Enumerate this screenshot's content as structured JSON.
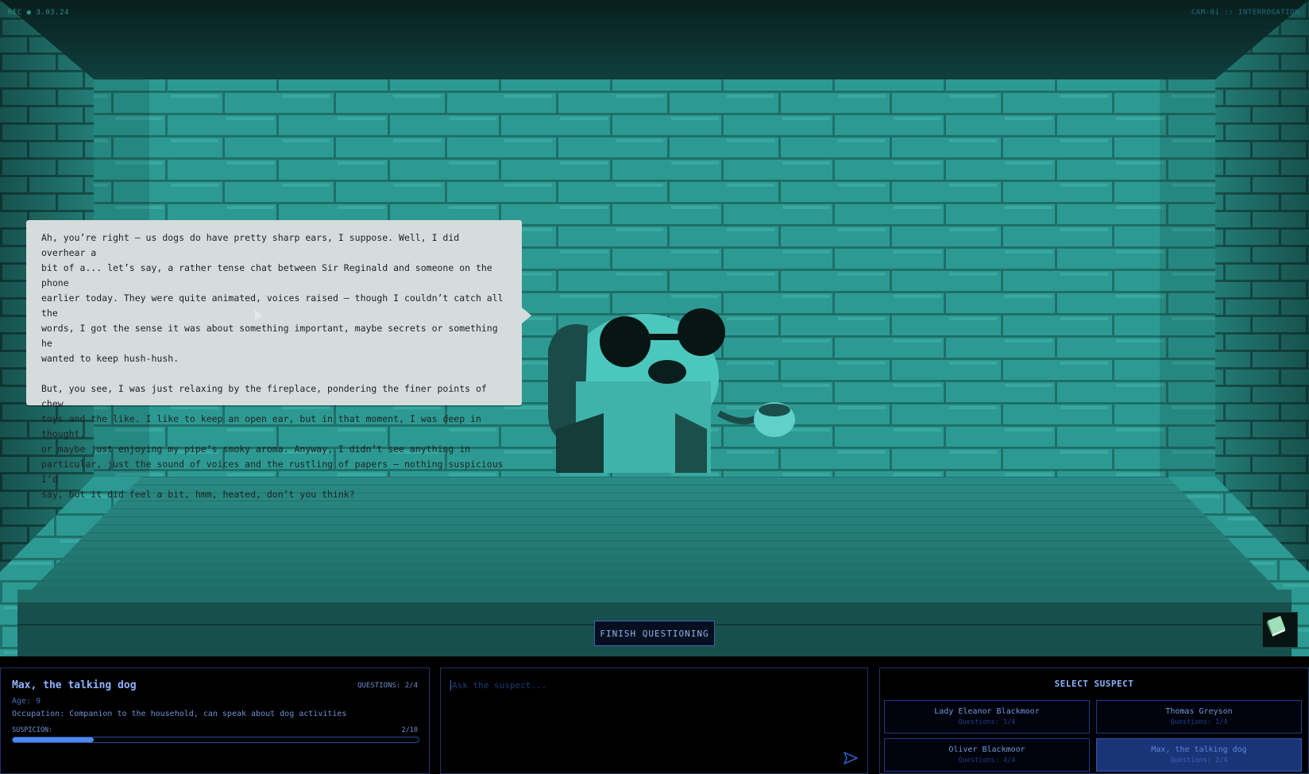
{
  "hud": {
    "left": "REC ● 3.03.24",
    "right": "CAM-01 :: INTERROGATION"
  },
  "dialogue": {
    "paragraphs": [
      "Ah, you’re right — us dogs do have pretty sharp ears, I suppose. Well, I did overhear a\nbit of a... let’s say, a rather tense chat between Sir Reginald and someone on the phone\nearlier today. They were quite animated, voices raised — though I couldn’t catch all the\nwords, I got the sense it was about something important, maybe secrets or something he\nwanted to keep hush-hush.",
      "But, you see, I was just relaxing by the fireplace, pondering the finer points of chew\ntoys and the like. I like to keep an open ear, but in that moment, I was deep in thought,\nor maybe just enjoying my pipe’s smoky aroma. Anyway, I didn’t see anything in\nparticular, just the sound of voices and the rustling of papers — nothing suspicious I’d\nsay, but it did feel a bit, hmm, heated, don’t you think?"
    ]
  },
  "actions": {
    "finish_label": "FINISH QUESTIONING",
    "notebook_icon": "notebook-icon"
  },
  "suspect_info": {
    "name": "Max, the talking dog",
    "questions": "QUESTIONS: 2/4",
    "age": "Age: 9",
    "occupation": "Occupation: Companion to the household, can speak about dog activities",
    "suspicion_label": "SUSPICION:",
    "suspicion_value": "2/10",
    "suspicion_fraction": 0.2
  },
  "ask": {
    "placeholder": "Ask the suspect...",
    "value": "",
    "send_icon": "send-icon"
  },
  "select": {
    "title": "SELECT SUSPECT",
    "suspects": [
      {
        "name": "Lady Eleanor Blackmoor",
        "questions": "Questions: 1/4"
      },
      {
        "name": "Thomas Greyson",
        "questions": "Questions: 1/4"
      },
      {
        "name": "Oliver Blackmoor",
        "questions": "Questions: 4/4"
      },
      {
        "name": "Max, the talking dog",
        "questions": "Questions: 2/4"
      }
    ]
  },
  "colors": {
    "scene": "#2f9e98",
    "panel_border": "#1c3470",
    "accent": "#4d8af0"
  }
}
